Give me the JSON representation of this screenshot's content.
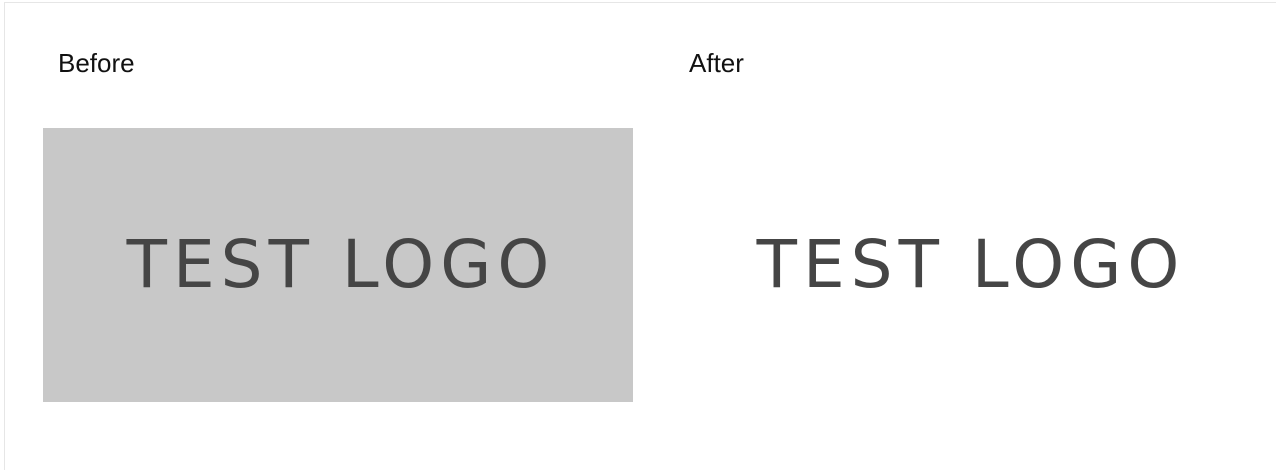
{
  "labels": {
    "before": "Before",
    "after": "After"
  },
  "logos": {
    "before": {
      "text": "TEST LOGO",
      "text_color": "#454545",
      "background_color": "#c8c8c8"
    },
    "after": {
      "text": "TEST LOGO",
      "text_color": "#454545",
      "background_color": "#ffffff"
    }
  }
}
